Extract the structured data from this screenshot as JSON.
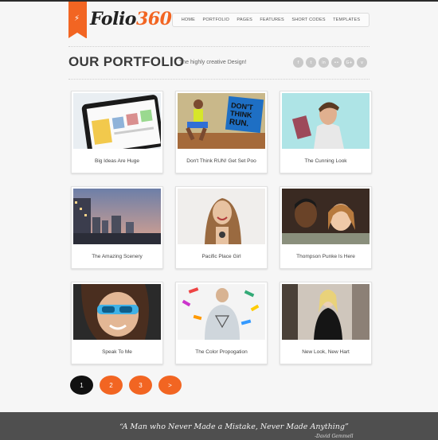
{
  "logo": {
    "word": "Folio",
    "number": "360",
    "icon": "lightning-bolt-icon"
  },
  "nav": {
    "items": [
      "HOME",
      "PORTFOLIO",
      "PAGES",
      "FEATURES",
      "SHORT CODES",
      "TEMPLATES"
    ]
  },
  "header": {
    "title": "OUR PORTFOLIO",
    "subtitle": "The highly creative Design!"
  },
  "social": {
    "icons": [
      "facebook-icon",
      "twitter-icon",
      "linkedin-icon",
      "flickr-icon",
      "googleplus-icon",
      "vimeo-icon"
    ],
    "glyphs": [
      "f",
      "t",
      "in",
      "••",
      "G+",
      "v"
    ]
  },
  "portfolio": {
    "items": [
      {
        "caption": "Big Ideas Are Huge"
      },
      {
        "caption": "Don't Think RUN! Get Set Poo"
      },
      {
        "caption": "The Cunning Look"
      },
      {
        "caption": "The Amazing Scenery"
      },
      {
        "caption": "Pacific Place Girl"
      },
      {
        "caption": "Thompson Punke Is Here"
      },
      {
        "caption": "Speak To Me"
      },
      {
        "caption": "The Color Propogation"
      },
      {
        "caption": "New Look, New Hart"
      }
    ],
    "poster_text": [
      "DON'T",
      "THINK",
      "RUN."
    ]
  },
  "pagination": {
    "pages": [
      "1",
      "2",
      "3",
      ">"
    ],
    "current": "1"
  },
  "footer": {
    "quote": "“A Man who Never Made a Mistake, Never Made Anything”",
    "author": "-David Gemmell"
  },
  "colors": {
    "accent": "#f26522",
    "footer": "#4f4f4f",
    "background": "#f6f6f6"
  }
}
